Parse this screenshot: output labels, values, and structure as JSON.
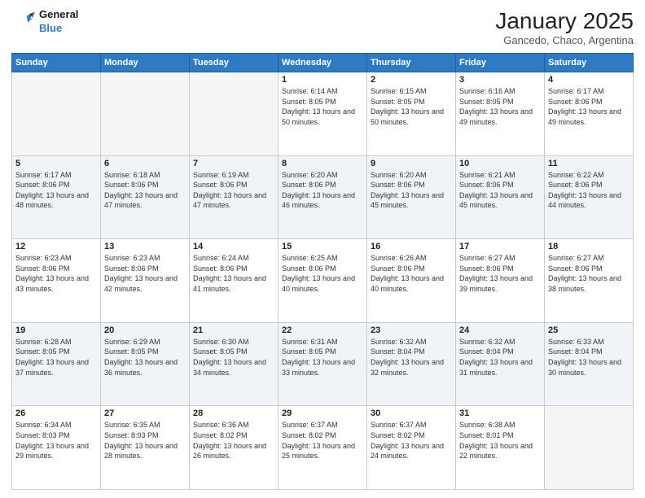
{
  "logo": {
    "line1": "General",
    "line2": "Blue"
  },
  "title": "January 2025",
  "location": "Gancedo, Chaco, Argentina",
  "weekdays": [
    "Sunday",
    "Monday",
    "Tuesday",
    "Wednesday",
    "Thursday",
    "Friday",
    "Saturday"
  ],
  "rows": [
    [
      {
        "day": "",
        "empty": true
      },
      {
        "day": "",
        "empty": true
      },
      {
        "day": "",
        "empty": true
      },
      {
        "day": "1",
        "sunrise": "6:14 AM",
        "sunset": "8:05 PM",
        "daylight": "13 hours and 50 minutes."
      },
      {
        "day": "2",
        "sunrise": "6:15 AM",
        "sunset": "8:05 PM",
        "daylight": "13 hours and 50 minutes."
      },
      {
        "day": "3",
        "sunrise": "6:16 AM",
        "sunset": "8:05 PM",
        "daylight": "13 hours and 49 minutes."
      },
      {
        "day": "4",
        "sunrise": "6:17 AM",
        "sunset": "8:06 PM",
        "daylight": "13 hours and 49 minutes."
      }
    ],
    [
      {
        "day": "5",
        "sunrise": "6:17 AM",
        "sunset": "8:06 PM",
        "daylight": "13 hours and 48 minutes."
      },
      {
        "day": "6",
        "sunrise": "6:18 AM",
        "sunset": "8:06 PM",
        "daylight": "13 hours and 47 minutes."
      },
      {
        "day": "7",
        "sunrise": "6:19 AM",
        "sunset": "8:06 PM",
        "daylight": "13 hours and 47 minutes."
      },
      {
        "day": "8",
        "sunrise": "6:20 AM",
        "sunset": "8:06 PM",
        "daylight": "13 hours and 46 minutes."
      },
      {
        "day": "9",
        "sunrise": "6:20 AM",
        "sunset": "8:06 PM",
        "daylight": "13 hours and 45 minutes."
      },
      {
        "day": "10",
        "sunrise": "6:21 AM",
        "sunset": "8:06 PM",
        "daylight": "13 hours and 45 minutes."
      },
      {
        "day": "11",
        "sunrise": "6:22 AM",
        "sunset": "8:06 PM",
        "daylight": "13 hours and 44 minutes."
      }
    ],
    [
      {
        "day": "12",
        "sunrise": "6:23 AM",
        "sunset": "8:06 PM",
        "daylight": "13 hours and 43 minutes."
      },
      {
        "day": "13",
        "sunrise": "6:23 AM",
        "sunset": "8:06 PM",
        "daylight": "13 hours and 42 minutes."
      },
      {
        "day": "14",
        "sunrise": "6:24 AM",
        "sunset": "8:06 PM",
        "daylight": "13 hours and 41 minutes."
      },
      {
        "day": "15",
        "sunrise": "6:25 AM",
        "sunset": "8:06 PM",
        "daylight": "13 hours and 40 minutes."
      },
      {
        "day": "16",
        "sunrise": "6:26 AM",
        "sunset": "8:06 PM",
        "daylight": "13 hours and 40 minutes."
      },
      {
        "day": "17",
        "sunrise": "6:27 AM",
        "sunset": "8:06 PM",
        "daylight": "13 hours and 39 minutes."
      },
      {
        "day": "18",
        "sunrise": "6:27 AM",
        "sunset": "8:06 PM",
        "daylight": "13 hours and 38 minutes."
      }
    ],
    [
      {
        "day": "19",
        "sunrise": "6:28 AM",
        "sunset": "8:05 PM",
        "daylight": "13 hours and 37 minutes."
      },
      {
        "day": "20",
        "sunrise": "6:29 AM",
        "sunset": "8:05 PM",
        "daylight": "13 hours and 36 minutes."
      },
      {
        "day": "21",
        "sunrise": "6:30 AM",
        "sunset": "8:05 PM",
        "daylight": "13 hours and 34 minutes."
      },
      {
        "day": "22",
        "sunrise": "6:31 AM",
        "sunset": "8:05 PM",
        "daylight": "13 hours and 33 minutes."
      },
      {
        "day": "23",
        "sunrise": "6:32 AM",
        "sunset": "8:04 PM",
        "daylight": "13 hours and 32 minutes."
      },
      {
        "day": "24",
        "sunrise": "6:32 AM",
        "sunset": "8:04 PM",
        "daylight": "13 hours and 31 minutes."
      },
      {
        "day": "25",
        "sunrise": "6:33 AM",
        "sunset": "8:04 PM",
        "daylight": "13 hours and 30 minutes."
      }
    ],
    [
      {
        "day": "26",
        "sunrise": "6:34 AM",
        "sunset": "8:03 PM",
        "daylight": "13 hours and 29 minutes."
      },
      {
        "day": "27",
        "sunrise": "6:35 AM",
        "sunset": "8:03 PM",
        "daylight": "13 hours and 28 minutes."
      },
      {
        "day": "28",
        "sunrise": "6:36 AM",
        "sunset": "8:02 PM",
        "daylight": "13 hours and 26 minutes."
      },
      {
        "day": "29",
        "sunrise": "6:37 AM",
        "sunset": "8:02 PM",
        "daylight": "13 hours and 25 minutes."
      },
      {
        "day": "30",
        "sunrise": "6:37 AM",
        "sunset": "8:02 PM",
        "daylight": "13 hours and 24 minutes."
      },
      {
        "day": "31",
        "sunrise": "6:38 AM",
        "sunset": "8:01 PM",
        "daylight": "13 hours and 22 minutes."
      },
      {
        "day": "",
        "empty": true
      }
    ]
  ]
}
